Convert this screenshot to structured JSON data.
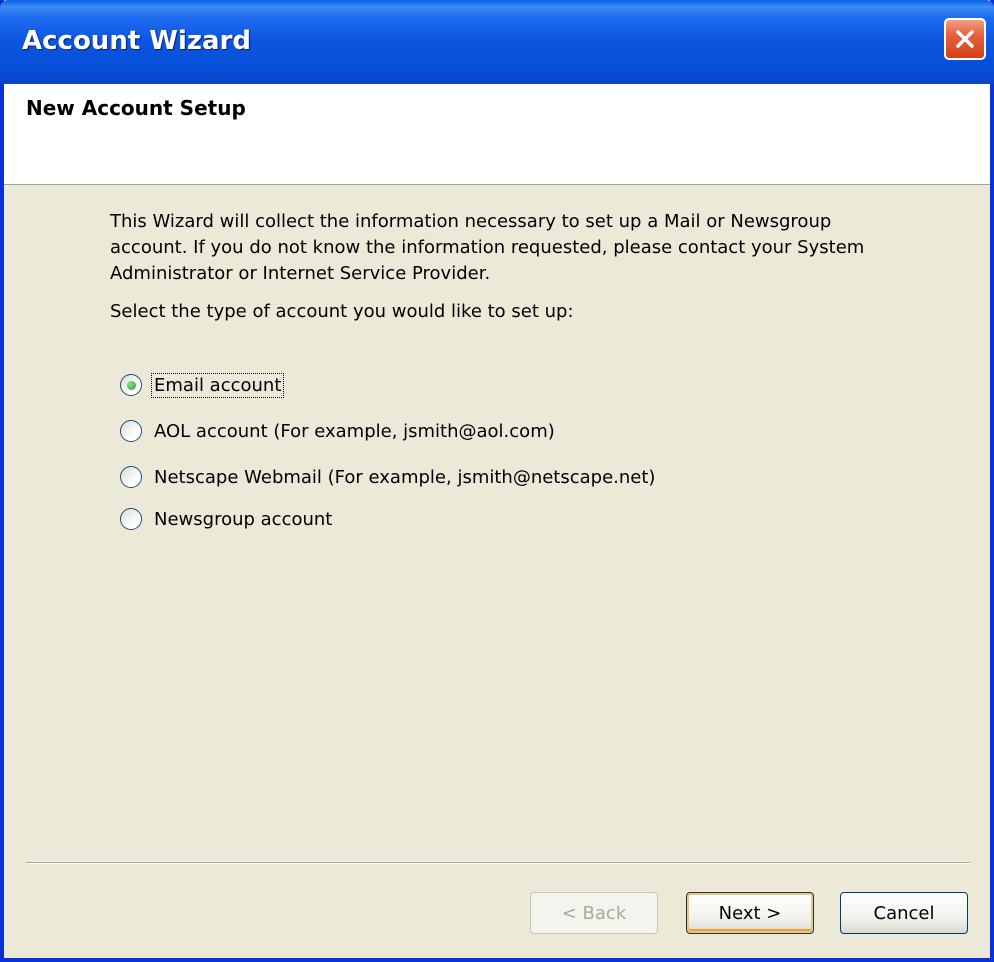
{
  "window": {
    "title": "Account Wizard"
  },
  "header": {
    "title": "New Account Setup"
  },
  "intro": {
    "text": "This Wizard will collect the information necessary to set up a Mail or Newsgroup account. If you do not know the information requested, please contact your System Administrator or Internet Service Provider."
  },
  "prompt": {
    "text": "Select the type of account you would like to set up:"
  },
  "account_types": [
    {
      "label": "Email account",
      "selected": true
    },
    {
      "label": "AOL account (For example, jsmith@aol.com)",
      "selected": false
    },
    {
      "label": "Netscape Webmail (For example, jsmith@netscape.net)",
      "selected": false
    },
    {
      "label": "Newsgroup account",
      "selected": false
    }
  ],
  "buttons": {
    "back": "< Back",
    "next": "Next >",
    "cancel": "Cancel"
  },
  "colors": {
    "titlebar": "#0a55e0",
    "body": "#ece9d8",
    "close": "#e5603b",
    "selected_dot": "#21a121"
  },
  "icons": {
    "close": "close-icon"
  }
}
